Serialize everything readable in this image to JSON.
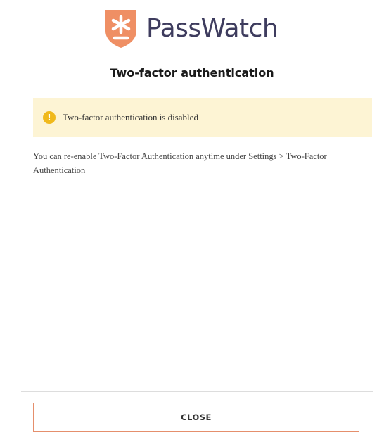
{
  "brand": {
    "name": "PassWatch",
    "logo_icon": "asterisk-shield-icon",
    "shield_color": "#ef8f64",
    "text_color": "#3e3c5e"
  },
  "dialog": {
    "title": "Two-factor authentication",
    "alert": {
      "icon": "warning-icon",
      "icon_glyph": "!",
      "text": "Two-factor authentication is disabled",
      "background": "#fdf4d4",
      "icon_color": "#f0b91c"
    },
    "message": "You can re-enable Two-Factor Authentication anytime under Settings > Two-Factor Authentication",
    "close_label": "CLOSE",
    "accent_color": "#e58f6c"
  }
}
